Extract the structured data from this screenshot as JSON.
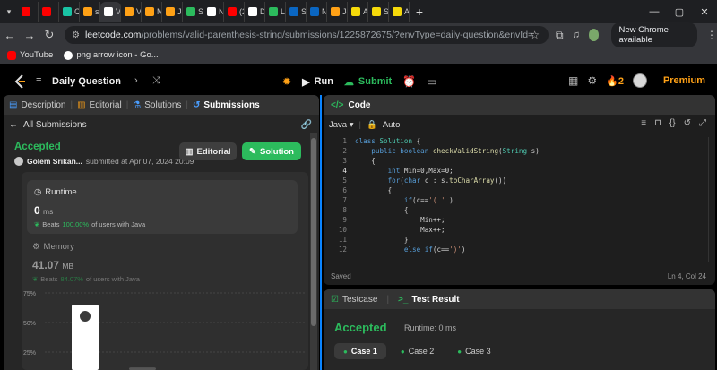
{
  "browser": {
    "tabs": [
      {
        "label": "",
        "color": "#ff0000"
      },
      {
        "label": "",
        "color": "#ff0000"
      },
      {
        "label": "Cl",
        "color": "#19c3a4"
      },
      {
        "label": "sr",
        "color": "#ffa116"
      },
      {
        "label": "Vc",
        "color": "#ffffff"
      },
      {
        "label": "Vo",
        "color": "#ffa116"
      },
      {
        "label": "M",
        "color": "#ffa116"
      },
      {
        "label": "Ja",
        "color": "#ffa116"
      },
      {
        "label": "St",
        "color": "#2cbb5d"
      },
      {
        "label": "N",
        "color": "#ffffff"
      },
      {
        "label": "(2",
        "color": "#ff0000"
      },
      {
        "label": "D",
        "color": "#ffffff"
      },
      {
        "label": "Li",
        "color": "#2cbb5d"
      },
      {
        "label": "Sl",
        "color": "#0a66c2"
      },
      {
        "label": "N",
        "color": "#0a66c2"
      },
      {
        "label": "Jc",
        "color": "#ffa116"
      },
      {
        "label": "A",
        "color": "#f5d90a"
      },
      {
        "label": "Sc",
        "color": "#f5d90a"
      },
      {
        "label": "A",
        "color": "#f5d90a"
      }
    ],
    "url_host": "leetcode.com",
    "url_path": "/problems/valid-parenthesis-string/submissions/1225872675/?envType=daily-question&envId=2024-04-07",
    "new_chrome": "New Chrome available",
    "bookmarks": [
      {
        "label": "YouTube",
        "color": "#ff0000"
      },
      {
        "label": "png arrow icon - Go...",
        "color": "#ffffff"
      }
    ]
  },
  "header": {
    "daily_question": "Daily Question",
    "run": "Run",
    "submit": "Submit",
    "streak": "2",
    "premium": "Premium"
  },
  "left": {
    "tabs": [
      "Description",
      "Editorial",
      "Solutions",
      "Submissions"
    ],
    "all_submissions": "All Submissions",
    "status": "Accepted",
    "author": "Golem Srikan...",
    "submitted_at": "submitted at Apr 07, 2024 20:09",
    "editorial_btn": "Editorial",
    "solution_btn": "Solution",
    "runtime": {
      "title": "Runtime",
      "value": "0",
      "unit": "ms",
      "beats_prefix": "Beats",
      "beats_pct": "100.00%",
      "beats_suffix": "of users with Java"
    },
    "memory": {
      "title": "Memory",
      "value": "41.07",
      "unit": "MB",
      "beats_prefix": "Beats",
      "beats_pct": "84.07%",
      "beats_suffix": "of users with Java"
    }
  },
  "chart_data": {
    "type": "bar",
    "title": "",
    "xlabel": "",
    "ylabel": "",
    "ytick_labels": [
      "75%",
      "50%",
      "25%"
    ],
    "ylim": [
      0,
      100
    ],
    "categories": [
      "my-runtime",
      "other"
    ],
    "values": [
      100,
      12
    ],
    "grid": true
  },
  "code": {
    "title": "Code",
    "language": "Java",
    "mode": "Auto",
    "saved": "Saved",
    "cursor": "Ln 4, Col 24",
    "current_line": 4
  },
  "result": {
    "tab_testcase": "Testcase",
    "tab_result": "Test Result",
    "status": "Accepted",
    "runtime": "Runtime: 0 ms",
    "cases": [
      "Case 1",
      "Case 2",
      "Case 3"
    ]
  }
}
